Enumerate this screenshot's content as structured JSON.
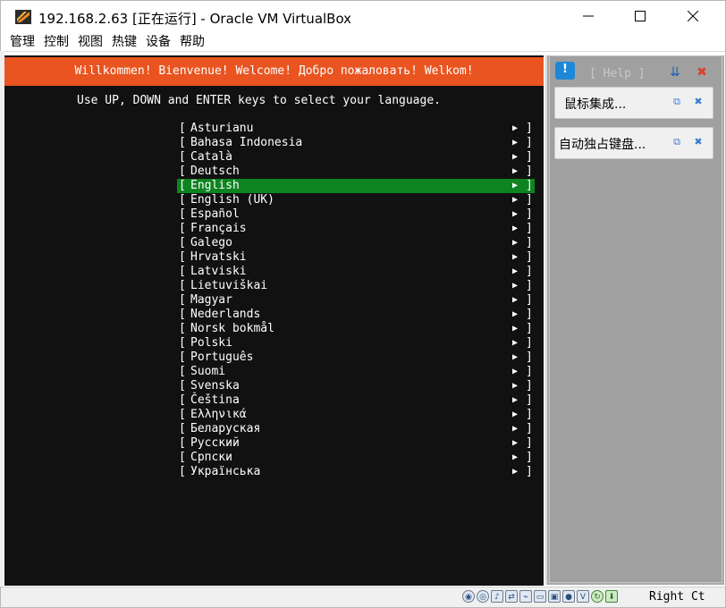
{
  "window": {
    "title": "192.168.2.63 [正在运行] - Oracle VM VirtualBox",
    "minimize_glyph": "—",
    "maximize_glyph": "☐",
    "close_glyph": "✕"
  },
  "menubar": {
    "items": [
      {
        "label": "管理"
      },
      {
        "label": "控制"
      },
      {
        "label": "视图"
      },
      {
        "label": "热键"
      },
      {
        "label": "设备"
      },
      {
        "label": "帮助"
      }
    ]
  },
  "installer": {
    "welcome": "Willkommen! Bienvenue! Welcome! Добро пожаловать! Welkom!",
    "instructions": "Use UP, DOWN and ENTER keys to select your language.",
    "bracket_open": "[",
    "bracket_close": "]",
    "arrow": "▶",
    "selected_index": 4,
    "languages": [
      "Asturianu",
      "Bahasa Indonesia",
      "Català",
      "Deutsch",
      "English",
      "English (UK)",
      "Español",
      "Français",
      "Galego",
      "Hrvatski",
      "Latviski",
      "Lietuviškai",
      "Magyar",
      "Nederlands",
      "Norsk bokmål",
      "Polski",
      "Português",
      "Suomi",
      "Svenska",
      "Čeština",
      "Ελληνικά",
      "Беларуская",
      "Русский",
      "Српски",
      "Українська"
    ],
    "colors": {
      "welcome_bg": "#e95420",
      "selected_bg": "#0e8420",
      "screen_bg": "#111111"
    }
  },
  "side_panel": {
    "help_label": "[ Help ]",
    "help_icon": "speech-bubble-icon",
    "notifications": [
      {
        "text": "鼠标集成..."
      },
      {
        "text": "自动独占键盘..."
      }
    ]
  },
  "statusbar": {
    "host_key": "Right Ct"
  }
}
